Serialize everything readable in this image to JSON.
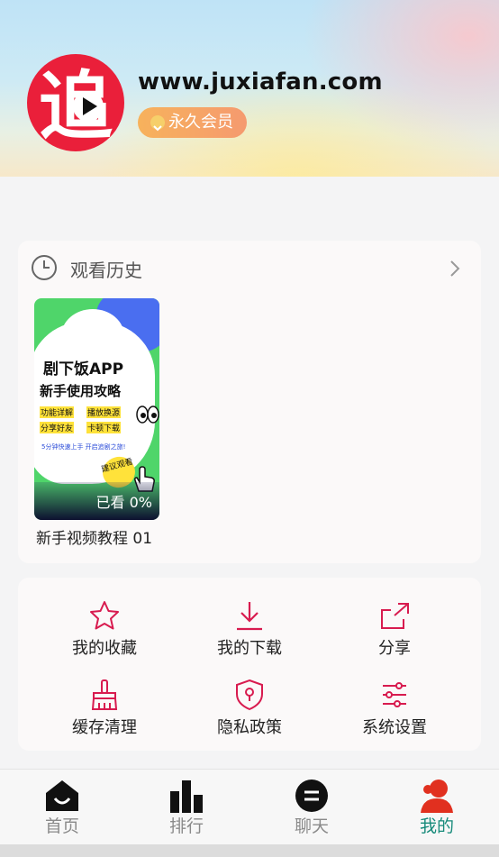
{
  "profile": {
    "logo_char": "追",
    "site_name": "www.juxiafan.com",
    "membership": "永久会员"
  },
  "history": {
    "title": "观看历史",
    "items": [
      {
        "thumb_title": "剧下饭APP",
        "thumb_subtitle": "新手使用攻略",
        "thumb_tags": [
          "功能详解",
          "播放换源",
          "分享好友",
          "卡顿下载"
        ],
        "thumb_note": "5分钟快速上手 开启追剧之旅!",
        "thumb_sticker": "建议观看",
        "progress": "已看 0%",
        "title": "新手视频教程 01"
      }
    ]
  },
  "menu": {
    "items": [
      {
        "label": "我的收藏",
        "icon": "star-icon"
      },
      {
        "label": "我的下载",
        "icon": "download-icon"
      },
      {
        "label": "分享",
        "icon": "share-icon"
      },
      {
        "label": "缓存清理",
        "icon": "broom-icon"
      },
      {
        "label": "隐私政策",
        "icon": "shield-lock-icon"
      },
      {
        "label": "系统设置",
        "icon": "sliders-icon"
      }
    ]
  },
  "nav": {
    "items": [
      {
        "label": "首页",
        "icon": "home-icon",
        "active": false
      },
      {
        "label": "排行",
        "icon": "bar-chart-icon",
        "active": false
      },
      {
        "label": "聊天",
        "icon": "chat-icon",
        "active": false
      },
      {
        "label": "我的",
        "icon": "user-icon",
        "active": true
      }
    ]
  },
  "colors": {
    "accent_menu": "#d81b4f",
    "nav_active": "#168a7a",
    "logo_red": "#ea1f3a",
    "vip_gradient": "#f7b25c"
  }
}
